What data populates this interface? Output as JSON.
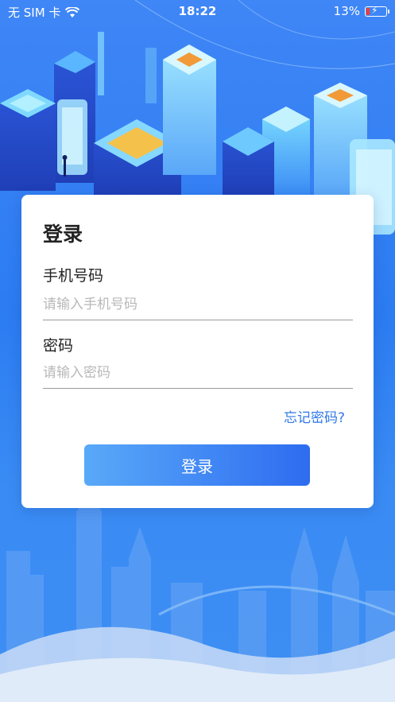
{
  "status_bar": {
    "carrier": "无 SIM 卡",
    "time": "18:22",
    "battery": "13%"
  },
  "login_card": {
    "title": "登录",
    "phone_label": "手机号码",
    "phone_placeholder": "请输入手机号码",
    "password_label": "密码",
    "password_placeholder": "请输入密码",
    "forgot_link": "忘记密码?",
    "submit_label": "登录"
  },
  "colors": {
    "background": "#2f7bf0",
    "accent": "#2f78e8",
    "button_start": "#59a9f9",
    "button_end": "#2e6cf0"
  }
}
